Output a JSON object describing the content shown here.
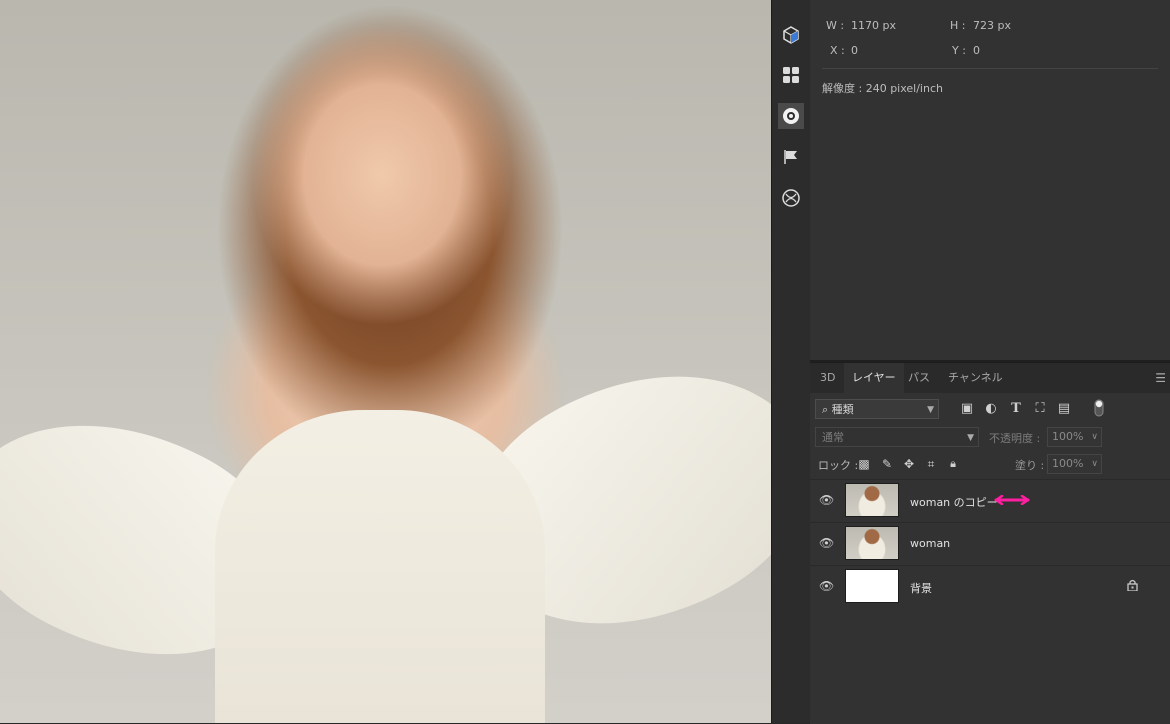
{
  "properties": {
    "w_label": "W :",
    "w_value": "1170 px",
    "h_label": "H :",
    "h_value": "723 px",
    "x_label": "X :",
    "x_value": "0",
    "y_label": "Y :",
    "y_value": "0",
    "resolution": "解像度 : 240 pixel/inch"
  },
  "tools": [
    {
      "icon": "3d-cube-icon"
    },
    {
      "icon": "grid-icon"
    },
    {
      "icon": "gear-badge-icon"
    },
    {
      "icon": "flag-icon"
    },
    {
      "icon": "sphere-icon"
    }
  ],
  "tabs": [
    {
      "label": "3D"
    },
    {
      "label": "レイヤー"
    },
    {
      "label": "パス"
    },
    {
      "label": "チャンネル"
    }
  ],
  "filter": {
    "kind_label": "種類"
  },
  "blend": {
    "mode": "通常",
    "opacity_label": "不透明度 :",
    "opacity_value": "100%"
  },
  "lock": {
    "label": "ロック :",
    "fill_label": "塗り :",
    "fill_value": "100%"
  },
  "layers": [
    {
      "name": "woman のコピー"
    },
    {
      "name": "woman"
    },
    {
      "name": "背景"
    }
  ],
  "colors": {
    "accent_arrow": "#ff1fa0"
  }
}
